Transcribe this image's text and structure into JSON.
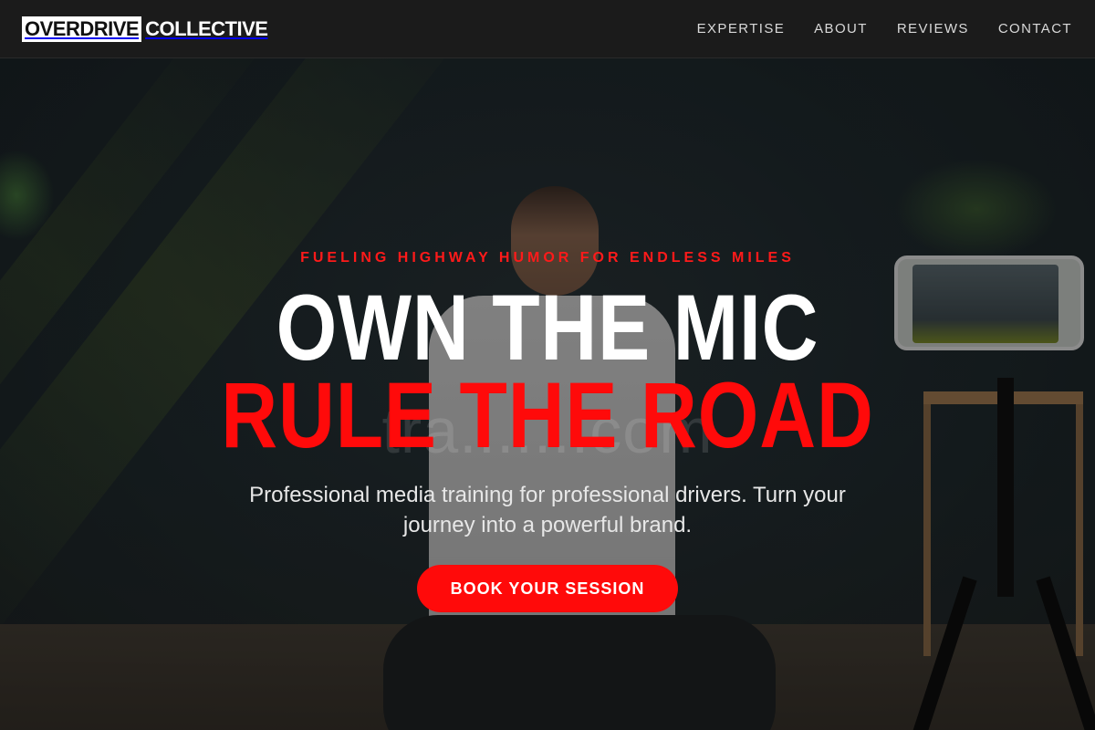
{
  "header": {
    "logo_part1": "OVERDRIVE",
    "logo_part2": "COLLECTIVE",
    "nav": [
      {
        "label": "EXPERTISE"
      },
      {
        "label": "ABOUT"
      },
      {
        "label": "REVIEWS"
      },
      {
        "label": "CONTACT"
      }
    ]
  },
  "hero": {
    "eyebrow": "FUELING HIGHWAY HUMOR FOR ENDLESS MILES",
    "headline_line1": "OWN THE MIC",
    "headline_line2": "RULE THE ROAD",
    "subtext": "Professional media training for professional drivers. Turn your journey into a powerful brand.",
    "cta_label": "BOOK YOUR SESSION",
    "background_watermark": "tra.......com"
  },
  "colors": {
    "accent_red": "#ff0a0a",
    "header_bg": "#1b1b1b",
    "text_white": "#ffffff"
  }
}
